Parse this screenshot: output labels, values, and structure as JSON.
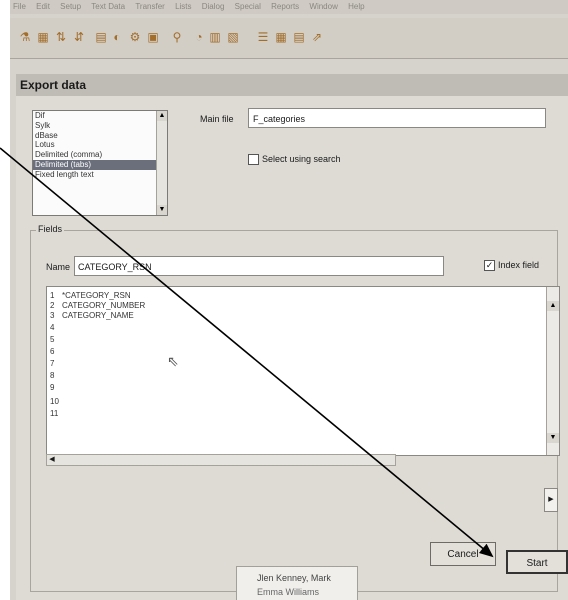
{
  "menubar": [
    "File",
    "Edit",
    "Setup",
    "Text Data",
    "Transfer",
    "Lists",
    "Dialog",
    "Special",
    "Reports",
    "Window",
    "Help"
  ],
  "dialog": {
    "title": "Export data",
    "formats": [
      "Dif",
      "Sylk",
      "dBase",
      "Lotus",
      "Delimited (comma)",
      "Delimited (tabs)",
      "Fixed length text"
    ],
    "selected_format": "Delimited (tabs)",
    "main_file_label": "Main file",
    "main_file_value": "F_categories",
    "select_using_search": {
      "label": "Select using search",
      "checked": false
    },
    "fields_label": "Fields",
    "name_label": "Name",
    "name_value": "CATEGORY_RSN",
    "index_field": {
      "label": "Index field",
      "checked": true
    },
    "field_lines": [
      {
        "n": "1",
        "text": "*CATEGORY_RSN"
      },
      {
        "n": "2",
        "text": "CATEGORY_NUMBER"
      },
      {
        "n": "3",
        "text": "CATEGORY_NAME"
      },
      {
        "n": "4",
        "text": ""
      },
      {
        "n": "5",
        "text": ""
      },
      {
        "n": "6",
        "text": ""
      },
      {
        "n": "7",
        "text": ""
      },
      {
        "n": "8",
        "text": ""
      },
      {
        "n": "9",
        "text": ""
      },
      {
        "n": "10",
        "text": ""
      },
      {
        "n": "11",
        "text": ""
      }
    ],
    "cancel_label": "Cancel",
    "start_label": "Start"
  },
  "background_window": {
    "line1": "Jlen Kenney, Mark",
    "line2": "Emma Williams"
  },
  "colors": {
    "arrow": "#000000",
    "selection": "#6b6f7c"
  }
}
